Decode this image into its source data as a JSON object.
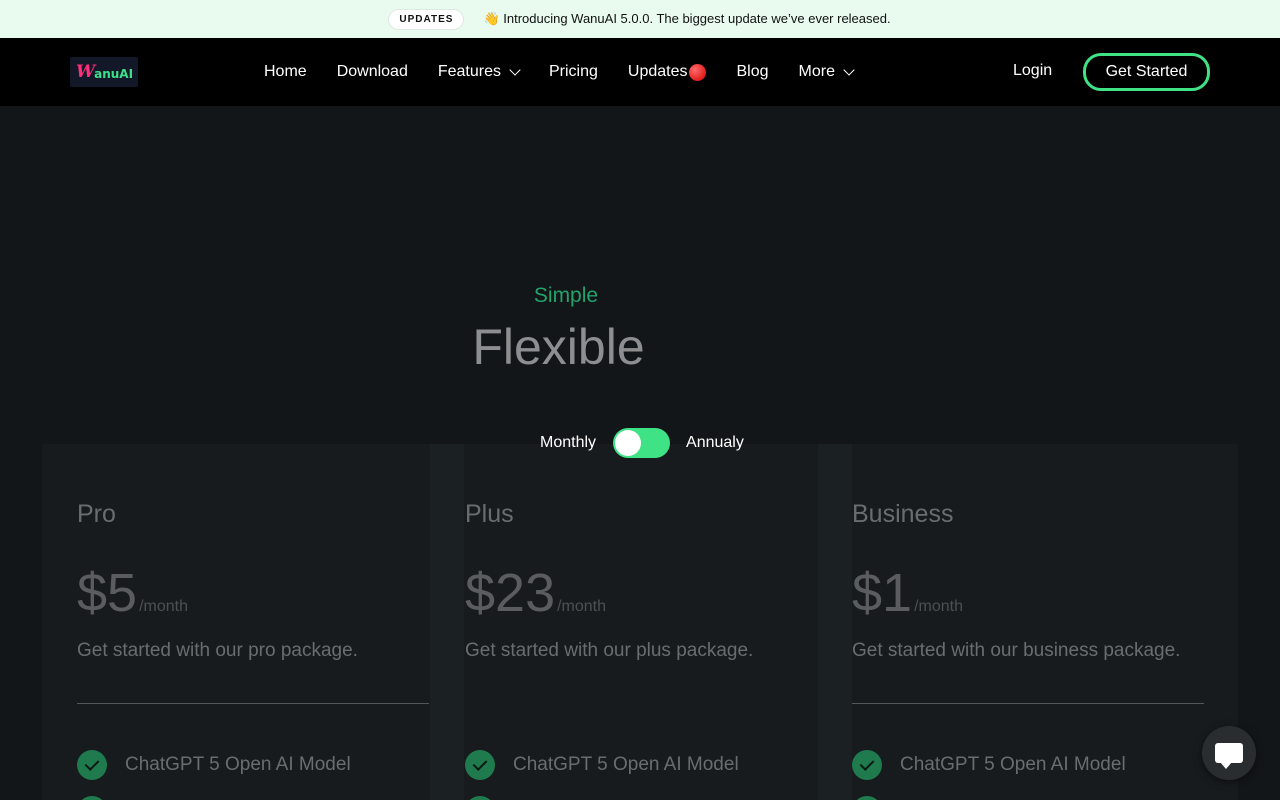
{
  "announcement": {
    "badge": "UPDATES",
    "message": "👋 Introducing WanuAI 5.0.0. The biggest update we’ve ever released."
  },
  "brand": {
    "logo_w": "W",
    "logo_rest": "anuAI"
  },
  "nav": {
    "items": [
      {
        "label": "Home"
      },
      {
        "label": "Download"
      },
      {
        "label": "Features",
        "icon": "chevron-down-icon"
      },
      {
        "label": "Pricing"
      },
      {
        "label": "Updates",
        "icon": "red-dot-icon"
      },
      {
        "label": "Blog"
      },
      {
        "label": "More",
        "icon": "chevron-down-icon"
      }
    ],
    "login": "Login",
    "cta": "Get Started"
  },
  "hero": {
    "eyebrow": "Simple",
    "headline": "Flexible"
  },
  "billing": {
    "monthly": "Monthly",
    "annual": "Annualy",
    "toggle_state": "monthly"
  },
  "plans": [
    {
      "name": "Pro",
      "price": "$5",
      "period": "/month",
      "description": "Get started with our pro package.",
      "features": [
        "ChatGPT 5 Open AI Model"
      ]
    },
    {
      "name": "Plus",
      "price": "$23",
      "period": "/month",
      "description": "Get started with our plus package.",
      "features": [
        "ChatGPT 5 Open AI Model"
      ]
    },
    {
      "name": "Business",
      "price": "$1",
      "period": "/month",
      "description": "Get started with our business package.",
      "features": [
        "ChatGPT 5 Open AI Model"
      ]
    }
  ],
  "colors": {
    "accent": "#3fe285",
    "eyebrow": "#22a36b",
    "announce_bg": "#e9fbef",
    "page_bg": "#131618"
  },
  "chat": {
    "icon": "chat-bubble-icon"
  }
}
